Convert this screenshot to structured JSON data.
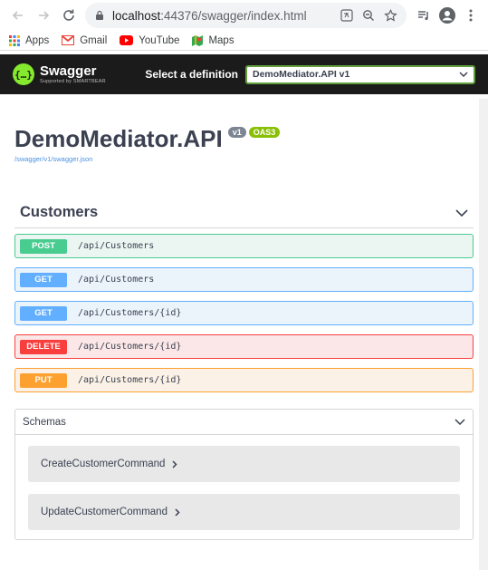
{
  "browser": {
    "url_host": "localhost",
    "url_rest": ":44376/swagger/index.html",
    "bookmarks": [
      {
        "label": "Apps",
        "icon": "apps-grid-icon"
      },
      {
        "label": "Gmail",
        "icon": "gmail-icon"
      },
      {
        "label": "YouTube",
        "icon": "youtube-icon"
      },
      {
        "label": "Maps",
        "icon": "maps-icon"
      }
    ]
  },
  "swagger": {
    "logo_title": "Swagger",
    "logo_sub": "Supported by SMARTBEAR",
    "definition_label": "Select a definition",
    "definition_value": "DemoMediator.API v1",
    "api_title": "DemoMediator.API",
    "version_badge": "v1",
    "oas_badge": "OAS3",
    "spec_link": "/swagger/v1/swagger.json",
    "tag": "Customers",
    "operations": [
      {
        "method": "POST",
        "path": "/api/Customers"
      },
      {
        "method": "GET",
        "path": "/api/Customers"
      },
      {
        "method": "GET",
        "path": "/api/Customers/{id}"
      },
      {
        "method": "DELETE",
        "path": "/api/Customers/{id}"
      },
      {
        "method": "PUT",
        "path": "/api/Customers/{id}"
      }
    ],
    "schemas_title": "Schemas",
    "schemas": [
      "CreateCustomerCommand",
      "UpdateCustomerCommand"
    ]
  },
  "colors": {
    "post": "#49cc90",
    "get": "#61affe",
    "delete": "#f93e3e",
    "put": "#fca130",
    "swagger_green": "#85ea2d",
    "topbar": "#1b1b1b"
  }
}
